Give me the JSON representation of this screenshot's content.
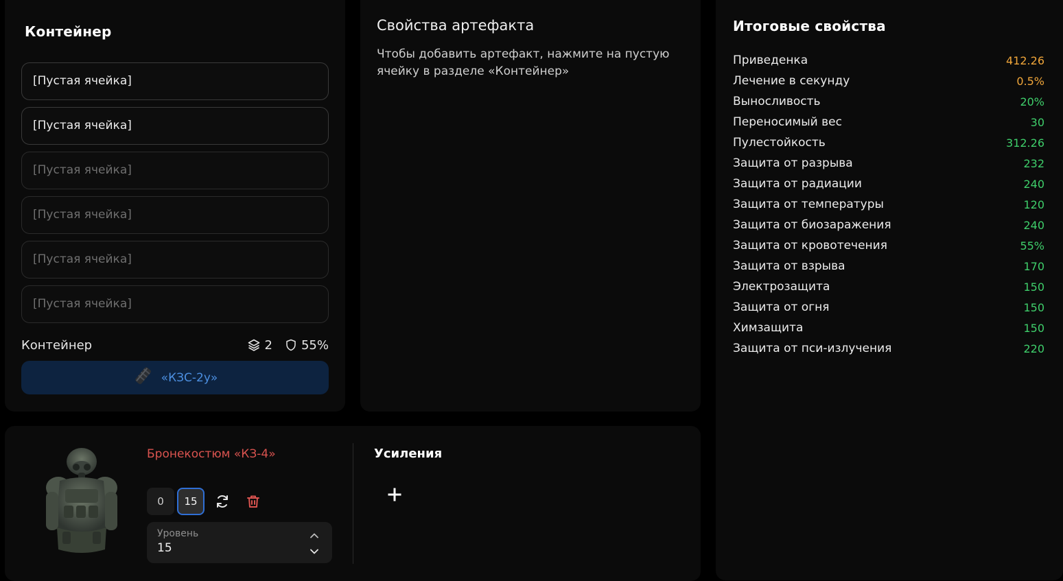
{
  "container": {
    "title": "Контейнер",
    "slots": [
      {
        "label": "[Пустая ячейка]"
      },
      {
        "label": "[Пустая ячейка]"
      },
      {
        "label": "[Пустая ячейка]"
      },
      {
        "label": "[Пустая ячейка]"
      },
      {
        "label": "[Пустая ячейка]"
      },
      {
        "label": "[Пустая ячейка]"
      }
    ],
    "footer_label": "Контейнер",
    "capacity": "2",
    "protection": "55%",
    "selected_name": "«КЗС-2у»",
    "icons": {
      "capacity": "layers-icon",
      "protection": "shield-icon",
      "container": "container-item-icon"
    }
  },
  "artifact": {
    "title": "Свойства артефакта",
    "hint": "Чтобы добавить артефакт, нажмите на пустую ячейку в разделе «Контейнер»"
  },
  "summary": {
    "title": "Итоговые свойства",
    "properties": [
      {
        "name": "Приведенка",
        "value": "412.26",
        "color": "#f0a63a"
      },
      {
        "name": "Лечение в секунду",
        "value": "0.5%",
        "color": "#f0a63a"
      },
      {
        "name": "Выносливость",
        "value": "20%",
        "color": "#3fcf6b"
      },
      {
        "name": "Переносимый вес",
        "value": "30",
        "color": "#3fcf6b"
      },
      {
        "name": "Пулестойкость",
        "value": "312.26",
        "color": "#3fcf6b"
      },
      {
        "name": "Защита от разрыва",
        "value": "232",
        "color": "#3fcf6b"
      },
      {
        "name": "Защита от радиации",
        "value": "240",
        "color": "#3fcf6b"
      },
      {
        "name": "Защита от температуры",
        "value": "120",
        "color": "#3fcf6b"
      },
      {
        "name": "Защита от биозаражения",
        "value": "240",
        "color": "#3fcf6b"
      },
      {
        "name": "Защита от кровотечения",
        "value": "55%",
        "color": "#3fcf6b"
      },
      {
        "name": "Защита от взрыва",
        "value": "170",
        "color": "#3fcf6b"
      },
      {
        "name": "Электрозащита",
        "value": "150",
        "color": "#3fcf6b"
      },
      {
        "name": "Защита от огня",
        "value": "150",
        "color": "#3fcf6b"
      },
      {
        "name": "Химзащита",
        "value": "150",
        "color": "#3fcf6b"
      },
      {
        "name": "Защита от пси-излучения",
        "value": "220",
        "color": "#3fcf6b"
      }
    ]
  },
  "armor": {
    "name": "Бронекостюм «КЗ-4»",
    "level_min": "0",
    "level_max": "15",
    "level_label": "Уровень",
    "level_value": "15",
    "icons": {
      "refresh": "refresh-icon",
      "delete": "trash-icon",
      "image": "armor-suit-image"
    }
  },
  "boosts": {
    "title": "Усиления",
    "add_icon": "plus-icon"
  },
  "colors": {
    "accent_blue": "#2f6fd6",
    "container_text": "#4c8fe0",
    "danger": "#d9534f",
    "orange": "#f0a63a",
    "green": "#3fcf6b"
  }
}
